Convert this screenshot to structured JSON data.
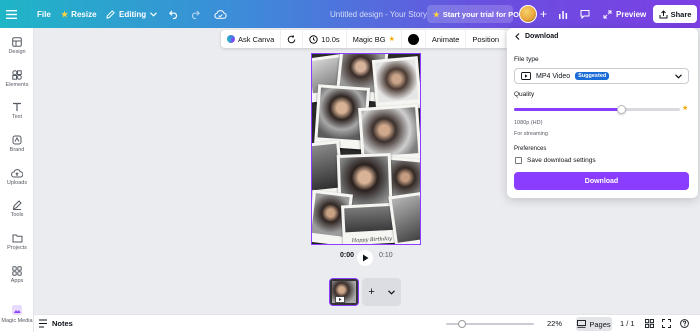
{
  "topbar": {
    "file_label": "File",
    "resize_label": "Resize",
    "editing_label": "Editing",
    "doc_title": "Untitled design - Your Story",
    "trial_label": "Start your trial for PO",
    "preview_label": "Preview",
    "share_label": "Share",
    "gradient": [
      "#1fb5c7",
      "#7b3fe4"
    ]
  },
  "sidebar": {
    "items": [
      {
        "label": "Design",
        "icon": "layout-icon"
      },
      {
        "label": "Elements",
        "icon": "shapes-icon"
      },
      {
        "label": "Text",
        "icon": "text-icon"
      },
      {
        "label": "Brand",
        "icon": "brand-icon"
      },
      {
        "label": "Uploads",
        "icon": "upload-icon"
      },
      {
        "label": "Tools",
        "icon": "pen-icon"
      },
      {
        "label": "Projects",
        "icon": "folder-icon"
      },
      {
        "label": "Apps",
        "icon": "apps-grid-icon"
      },
      {
        "label": "Magic Media",
        "icon": "magic-media-icon"
      }
    ]
  },
  "context_toolbar": {
    "ask_canva": "Ask Canva",
    "duration": "10.0s",
    "magic_bg": "Magic BG",
    "animate": "Animate",
    "position": "Position"
  },
  "canvas": {
    "caption": "Happy Birthday"
  },
  "playback": {
    "current_time": "0:00",
    "total_time": "0:10"
  },
  "bottombar": {
    "notes_label": "Notes",
    "zoom": "22%",
    "pages_label": "Pages",
    "page_count": "1 / 1"
  },
  "download_panel": {
    "title": "Download",
    "file_type_label": "File type",
    "file_type_value": "MP4 Video",
    "suggested_badge": "Suggested",
    "quality_label": "Quality",
    "quality_fraction": 0.65,
    "quality_value": "1080p (HD)",
    "quality_hint": "For streaming",
    "preferences_label": "Preferences",
    "save_settings_label": "Save download settings",
    "save_settings_checked": false,
    "download_button": "Download",
    "accent": "#8b3dff"
  }
}
